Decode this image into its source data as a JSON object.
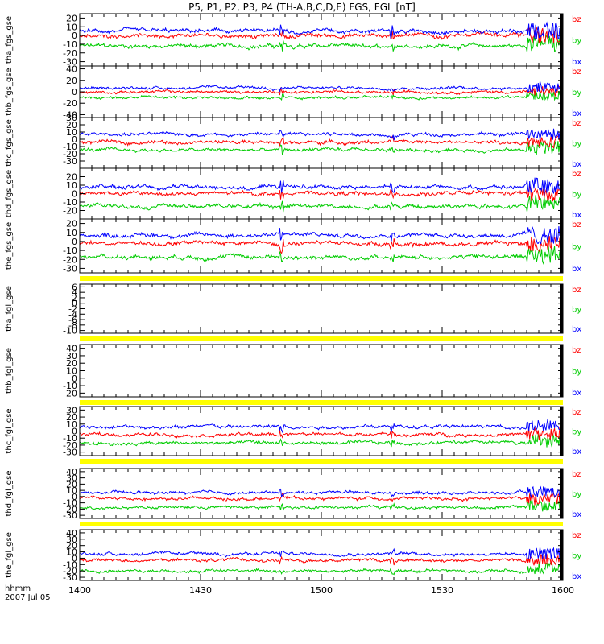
{
  "title": "P5, P1, P2, P3, P4 (TH-A,B,C,D,E) FGS, FGL [nT]",
  "time_unit_label": "hhmm",
  "date_label": "2007 Jul 05",
  "colors": {
    "bz": "#ff0000",
    "by": "#00cc00",
    "bx": "#0000ff",
    "gap": "#ffff00",
    "axis": "#000000"
  },
  "chart_data": {
    "type": "line",
    "x_ticks": [
      "1400",
      "1430",
      "1500",
      "1530",
      "1600"
    ],
    "xlim": [
      1400,
      1600
    ],
    "legend": [
      "bz",
      "by",
      "bx"
    ],
    "panels": [
      {
        "ylabel": "tha_fgs_gse",
        "ylim": [
          -35,
          25
        ],
        "yticks": [
          -30,
          -20,
          -10,
          0,
          10,
          20
        ],
        "has_data": true,
        "bx_mean": 5,
        "by_mean": 0,
        "bz_mean": -12
      },
      {
        "ylabel": "thb_fgs_gse",
        "ylim": [
          -45,
          45
        ],
        "yticks": [
          -40,
          -20,
          0,
          20,
          40
        ],
        "has_data": true,
        "bx_mean": 7,
        "by_mean": 0,
        "bz_mean": -10
      },
      {
        "ylabel": "thc_fgs_gse",
        "ylim": [
          -40,
          30
        ],
        "yticks": [
          -30,
          -20,
          -10,
          0,
          10,
          20,
          30
        ],
        "has_data": true,
        "bx_mean": 7,
        "by_mean": -4,
        "bz_mean": -15
      },
      {
        "ylabel": "thd_fgs_gse",
        "ylim": [
          -30,
          30
        ],
        "yticks": [
          -20,
          -10,
          0,
          10,
          20
        ],
        "has_data": true,
        "bx_mean": 8,
        "by_mean": 0,
        "bz_mean": -15
      },
      {
        "ylabel": "the_fgs_gse",
        "ylim": [
          -35,
          25
        ],
        "yticks": [
          -30,
          -20,
          -10,
          0,
          10,
          20
        ],
        "has_data": true,
        "bx_mean": 7,
        "by_mean": -2,
        "bz_mean": -17
      },
      {
        "ylabel": "tha_fgl_gse",
        "ylim": [
          -11,
          7
        ],
        "yticks": [
          -10,
          -8,
          -6,
          -4,
          -2,
          0,
          2,
          4,
          6
        ],
        "has_data": false
      },
      {
        "ylabel": "thb_fgl_gse",
        "ylim": [
          -25,
          45
        ],
        "yticks": [
          -20,
          -10,
          0,
          10,
          20,
          30,
          40
        ],
        "has_data": false
      },
      {
        "ylabel": "thc_fgl_gse",
        "ylim": [
          -35,
          35
        ],
        "yticks": [
          -30,
          -20,
          -10,
          0,
          10,
          20,
          30
        ],
        "has_data": true,
        "bx_mean": 6,
        "by_mean": -5,
        "bz_mean": -17
      },
      {
        "ylabel": "thd_fgl_gse",
        "ylim": [
          -35,
          45
        ],
        "yticks": [
          -30,
          -20,
          -10,
          0,
          10,
          20,
          30,
          40
        ],
        "has_data": true,
        "bx_mean": 6,
        "by_mean": -3,
        "bz_mean": -17
      },
      {
        "ylabel": "the_fgl_gse",
        "ylim": [
          -35,
          45
        ],
        "yticks": [
          -30,
          -20,
          -10,
          0,
          10,
          20,
          30,
          40
        ],
        "has_data": true,
        "bx_mean": 7,
        "by_mean": -3,
        "bz_mean": -20
      }
    ]
  }
}
